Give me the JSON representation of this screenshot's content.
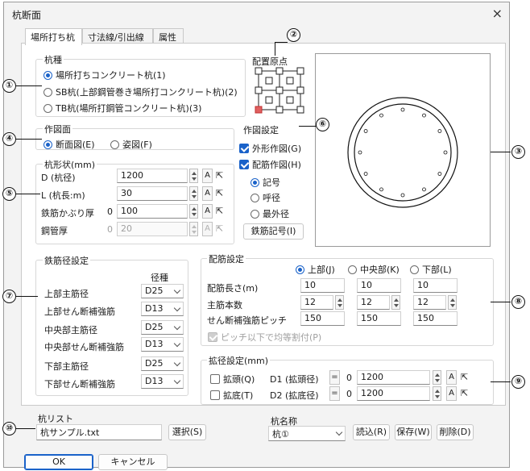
{
  "window": {
    "title": "杭断面",
    "close_icon": "×"
  },
  "tabs": [
    {
      "label": "場所打ち杭"
    },
    {
      "label": "寸法線/引出線"
    },
    {
      "label": "属性"
    }
  ],
  "pile_type": {
    "label": "杭種",
    "options": [
      {
        "label": "場所打ちコンクリート杭(1)",
        "selected": true
      },
      {
        "label": "SB杭(上部鋼管巻き場所打コンクリート杭)(2)",
        "selected": false
      },
      {
        "label": "TB杭(場所打鋼管コンクリート杭)(3)",
        "selected": false
      }
    ]
  },
  "origin": {
    "label": "配置原点"
  },
  "drawing_face": {
    "label": "作図面",
    "options": [
      {
        "label": "断面図(E)",
        "selected": true
      },
      {
        "label": "姿図(F)",
        "selected": false
      }
    ]
  },
  "drawing_settings": {
    "label": "作図設定",
    "outline": {
      "label": "外形作図(G)",
      "checked": true
    },
    "rebar": {
      "label": "配筋作図(H)",
      "checked": true
    },
    "rebar_label_options": [
      {
        "label": "記号",
        "selected": true
      },
      {
        "label": "呼径",
        "selected": false
      },
      {
        "label": "最外径",
        "selected": false
      }
    ],
    "rebar_symbol_button": "鉄筋記号(I)"
  },
  "pile_shape": {
    "label": "杭形状(mm)",
    "rows": [
      {
        "label": "D (杭径)",
        "value": "1200",
        "prefix": "",
        "a": "A",
        "disabled": false
      },
      {
        "label": "L (杭長:m)",
        "value": "30",
        "prefix": "",
        "a": "A",
        "disabled": false
      },
      {
        "label": "鉄筋かぶり厚",
        "value": "100",
        "prefix": "0",
        "a": "A",
        "disabled": false
      },
      {
        "label": "鋼管厚",
        "value": "20",
        "prefix": "0",
        "a": "A",
        "disabled": true
      }
    ]
  },
  "rebar_diameter": {
    "label": "鉄筋径設定",
    "header": "径種",
    "rows": [
      {
        "label": "上部主筋径",
        "value": "D25"
      },
      {
        "label": "上部せん断補強筋",
        "value": "D13"
      },
      {
        "label": "中央部主筋径",
        "value": "D25"
      },
      {
        "label": "中央部せん断補強筋",
        "value": "D13"
      },
      {
        "label": "下部主筋径",
        "value": "D25"
      },
      {
        "label": "下部せん断補強筋",
        "value": "D13"
      }
    ]
  },
  "rebar_layout": {
    "label": "配筋設定",
    "sections": [
      {
        "label": "上部(J)",
        "selected": true
      },
      {
        "label": "中央部(K)",
        "selected": false
      },
      {
        "label": "下部(L)",
        "selected": false
      }
    ],
    "rows": [
      {
        "label": "配筋長さ(m)",
        "values": [
          "10",
          "10",
          "10"
        ]
      },
      {
        "label": "主筋本数",
        "values": [
          "12",
          "12",
          "12"
        ]
      },
      {
        "label": "せん断補強筋ピッチ",
        "values": [
          "150",
          "150",
          "150"
        ]
      }
    ],
    "equal_split": {
      "label": "ピッチ以下で均等割付(P)",
      "checked": true,
      "disabled": true
    }
  },
  "enlarge": {
    "label": "拡径設定(mm)",
    "rows": [
      {
        "check_label": "拡頭(Q)",
        "field_label": "D1 (拡頭径)",
        "eq": "=",
        "prefix": "0",
        "value": "1200",
        "a": "A"
      },
      {
        "check_label": "拡底(T)",
        "field_label": "D2 (拡底径)",
        "eq": "=",
        "prefix": "0",
        "value": "1200",
        "a": "A"
      }
    ]
  },
  "pile_list": {
    "label": "杭リスト",
    "value": "杭サンプル.txt",
    "select_button": "選択(S)"
  },
  "pile_name": {
    "label": "杭名称",
    "value": "杭①",
    "read_button": "読込(R)",
    "save_button": "保存(W)",
    "delete_button": "削除(D)"
  },
  "footer": {
    "ok": "OK",
    "cancel": "キャンセル"
  },
  "callouts": [
    "①",
    "②",
    "③",
    "④",
    "⑤",
    "⑥",
    "⑦",
    "⑧",
    "⑨",
    "⑩"
  ]
}
